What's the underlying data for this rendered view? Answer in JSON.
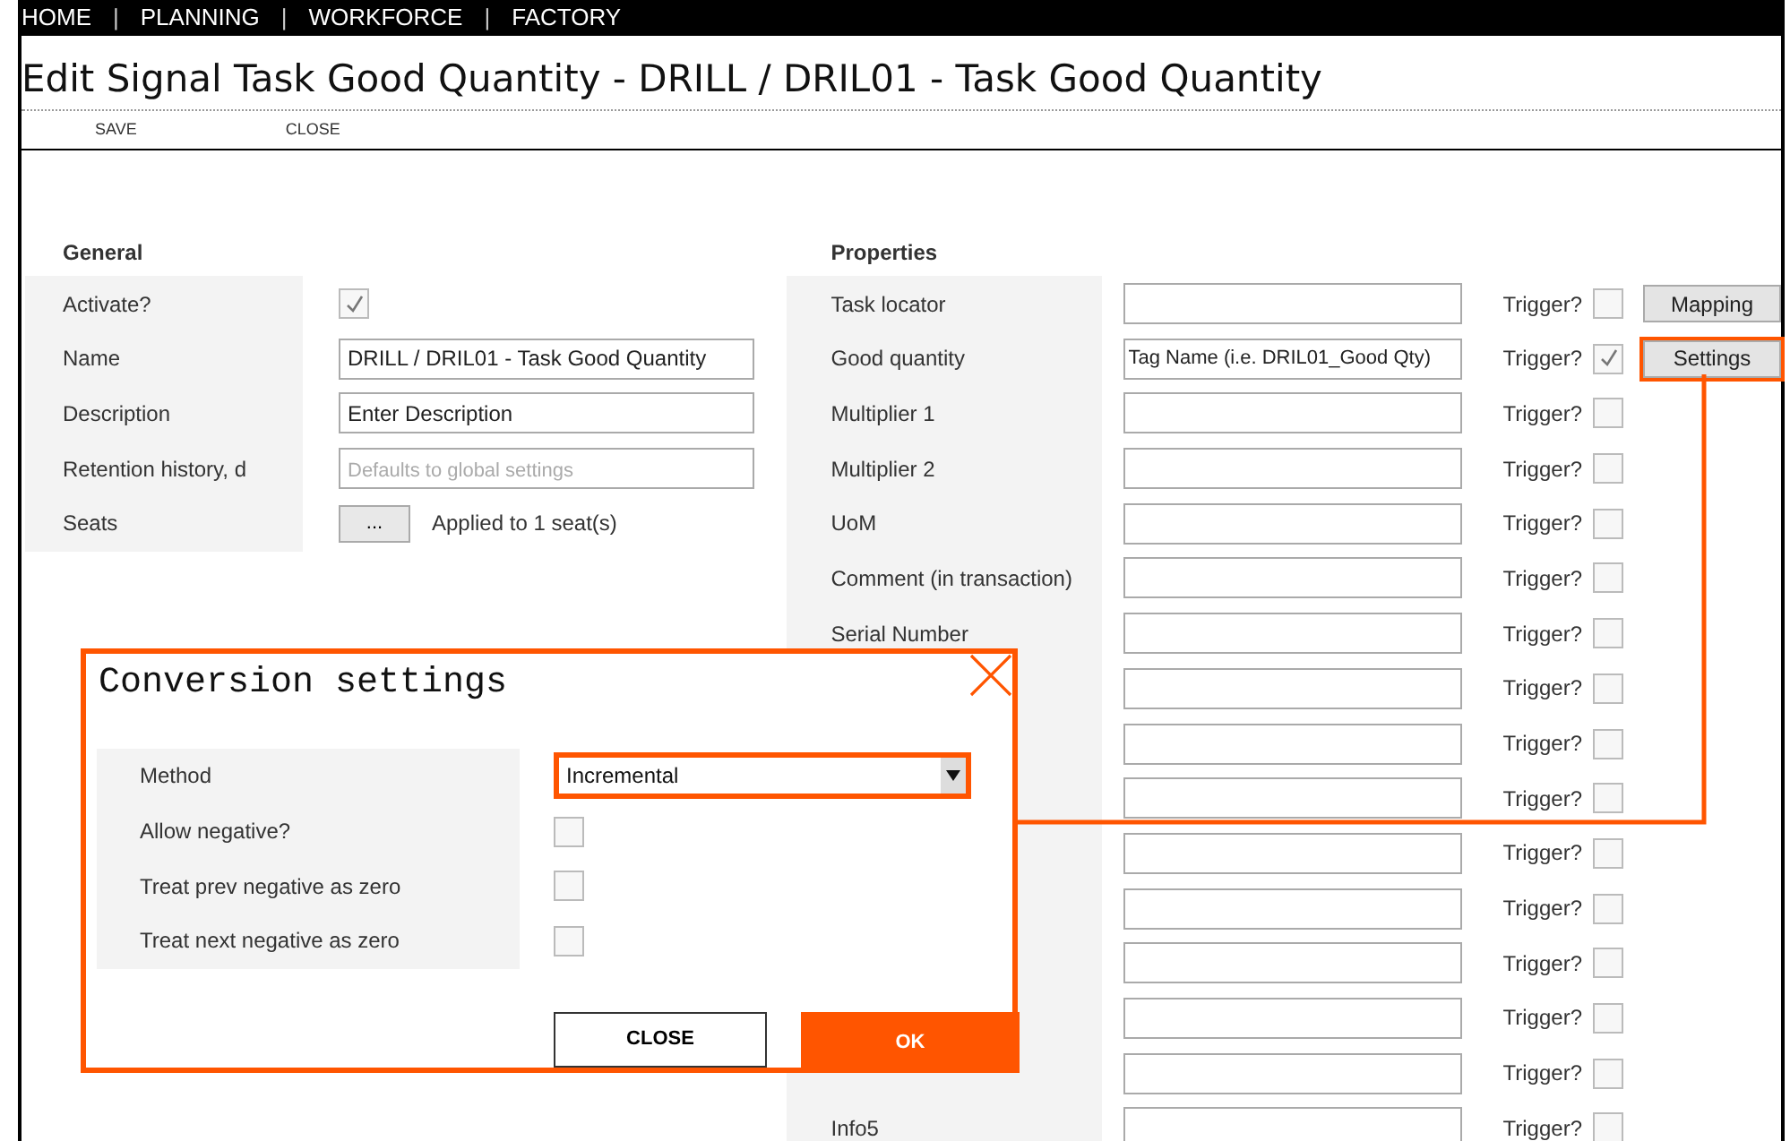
{
  "nav": [
    {
      "kind": "link",
      "label": "HOME"
    },
    {
      "kind": "separator",
      "label": "|"
    },
    {
      "kind": "link",
      "label": "PLANNING"
    },
    {
      "kind": "separator",
      "label": "|"
    },
    {
      "kind": "link",
      "label": "WORKFORCE"
    },
    {
      "kind": "separator",
      "label": "|"
    },
    {
      "kind": "link",
      "label": "FACTORY"
    }
  ],
  "title": "Edit Signal Task Good Quantity - DRILL / DRIL01 - Task Good Quantity",
  "toolbar": [
    "SAVE",
    "CLOSE"
  ],
  "general": {
    "heading": "General",
    "fields": [
      {
        "label": "Activate?",
        "kind": "checkbox",
        "checked": true
      },
      {
        "label": "Name",
        "kind": "text",
        "value": "DRILL / DRIL01 - Task Good Quantity"
      },
      {
        "label": "Description",
        "kind": "text",
        "value": "Enter Description"
      },
      {
        "label": "Retention history, d",
        "kind": "text",
        "placeholder": "Defaults to global settings"
      },
      {
        "label": "Seats",
        "kind": "seats",
        "button": "...",
        "note": "Applied to 1 seat(s)"
      }
    ]
  },
  "properties": {
    "heading": "Properties",
    "rows": [
      {
        "label": "Task locator",
        "trigger": "Trigger?",
        "trigger_checked": false,
        "button": {
          "label": "Mapping",
          "highlighted": false
        }
      },
      {
        "label": "Good quantity",
        "value": "Tag Name (i.e. DRIL01_Good Qty)",
        "trigger": "Trigger?",
        "trigger_checked": true,
        "button": {
          "label": "Settings",
          "highlighted": true
        }
      },
      {
        "label": "Multiplier 1",
        "trigger": "Trigger?",
        "trigger_checked": false
      },
      {
        "label": "Multiplier 2",
        "trigger": "Trigger?",
        "trigger_checked": false
      },
      {
        "label": "UoM",
        "trigger": "Trigger?",
        "trigger_checked": false
      },
      {
        "label": "Comment (in transaction)",
        "trigger": "Trigger?",
        "trigger_checked": false
      },
      {
        "label": "Serial Number",
        "trigger": "Trigger?",
        "trigger_checked": false
      },
      {
        "trigger": "Trigger?",
        "trigger_checked": false
      },
      {
        "trigger": "Trigger?",
        "trigger_checked": false
      },
      {
        "trigger": "Trigger?",
        "trigger_checked": false
      },
      {
        "trigger": "Trigger?",
        "trigger_checked": false
      },
      {
        "trigger": "Trigger?",
        "trigger_checked": false
      },
      {
        "trigger": "Trigger?",
        "trigger_checked": false
      },
      {
        "trigger": "Trigger?",
        "trigger_checked": false
      },
      {
        "trigger": "Trigger?",
        "trigger_checked": false
      },
      {
        "label": "Info5",
        "trigger": "Trigger?",
        "trigger_checked": false
      }
    ]
  },
  "dialog": {
    "title": "Conversion settings",
    "fields": [
      {
        "label": "Method",
        "kind": "select",
        "value": "Incremental",
        "highlighted": true
      },
      {
        "label": "Allow negative?",
        "kind": "checkbox",
        "checked": false
      },
      {
        "label": "Treat prev negative as zero",
        "kind": "checkbox",
        "checked": false
      },
      {
        "label": "Treat next negative as zero",
        "kind": "checkbox",
        "checked": false
      }
    ],
    "buttons": [
      {
        "label": "CLOSE",
        "kind": "secondary"
      },
      {
        "label": "OK",
        "kind": "primary"
      }
    ]
  }
}
